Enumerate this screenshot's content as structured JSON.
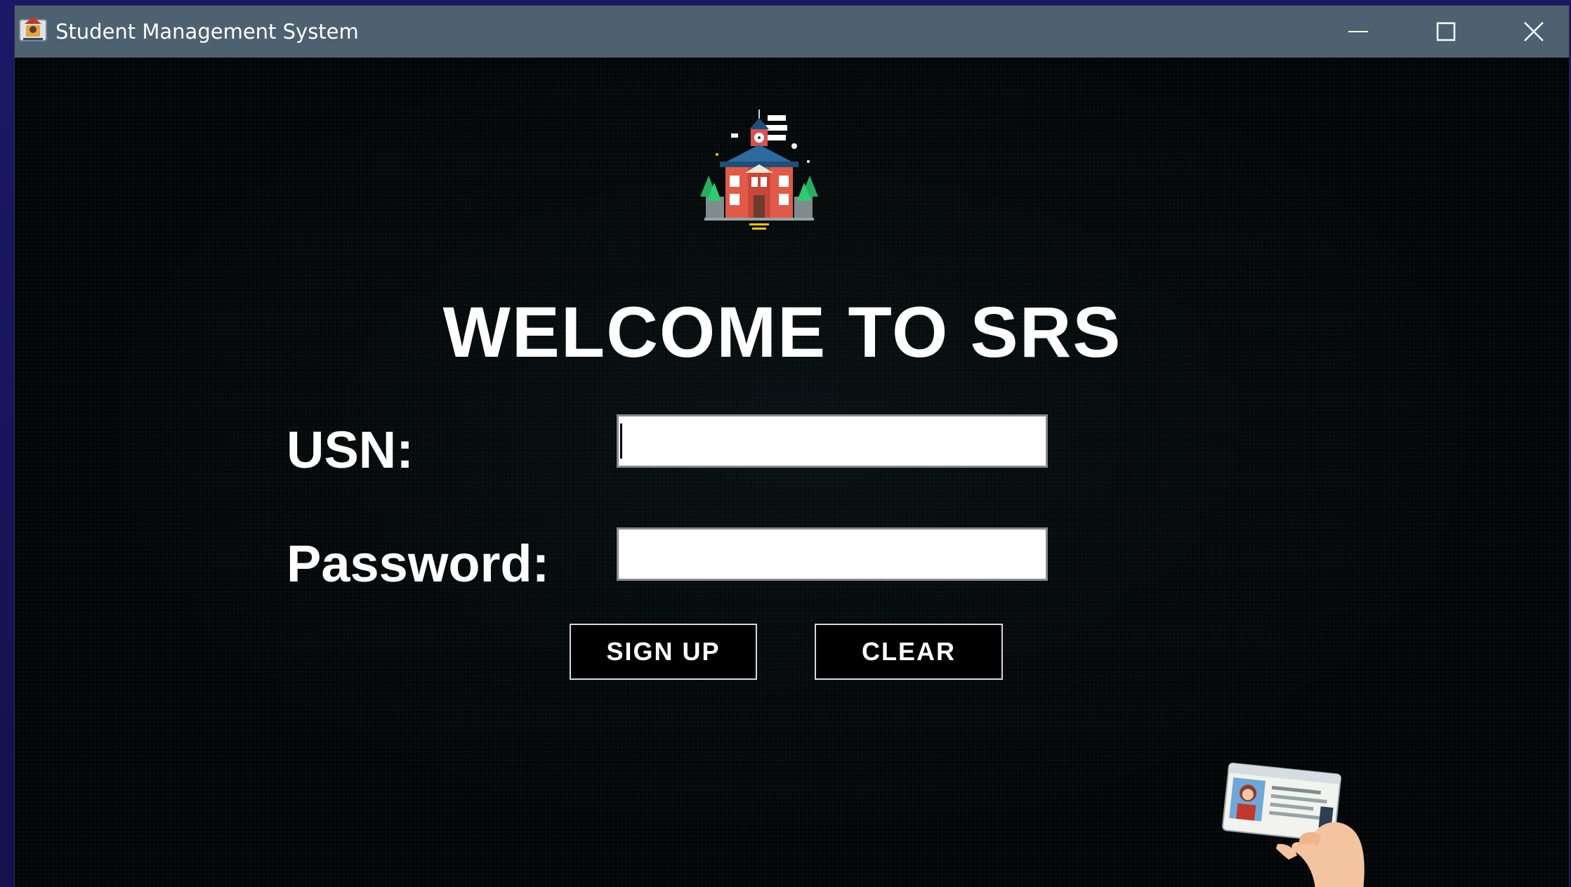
{
  "window": {
    "title": "Student Management System",
    "controls": [
      "minimize",
      "maximize",
      "close"
    ]
  },
  "icons": {
    "app": "app-icon",
    "logo": "school-building-icon",
    "illustration": "hand-holding-id-card-icon"
  },
  "main": {
    "heading": "WELCOME TO SRS",
    "usn_label": "USN:",
    "usn_value": "",
    "password_label": "Password:",
    "password_value": "",
    "signup_button": "SIGN UP",
    "clear_button": "CLEAR"
  },
  "colors": {
    "titlebar": "#4d6170",
    "background": "#030405",
    "text": "#ffffff",
    "desktop": "#17145a"
  }
}
